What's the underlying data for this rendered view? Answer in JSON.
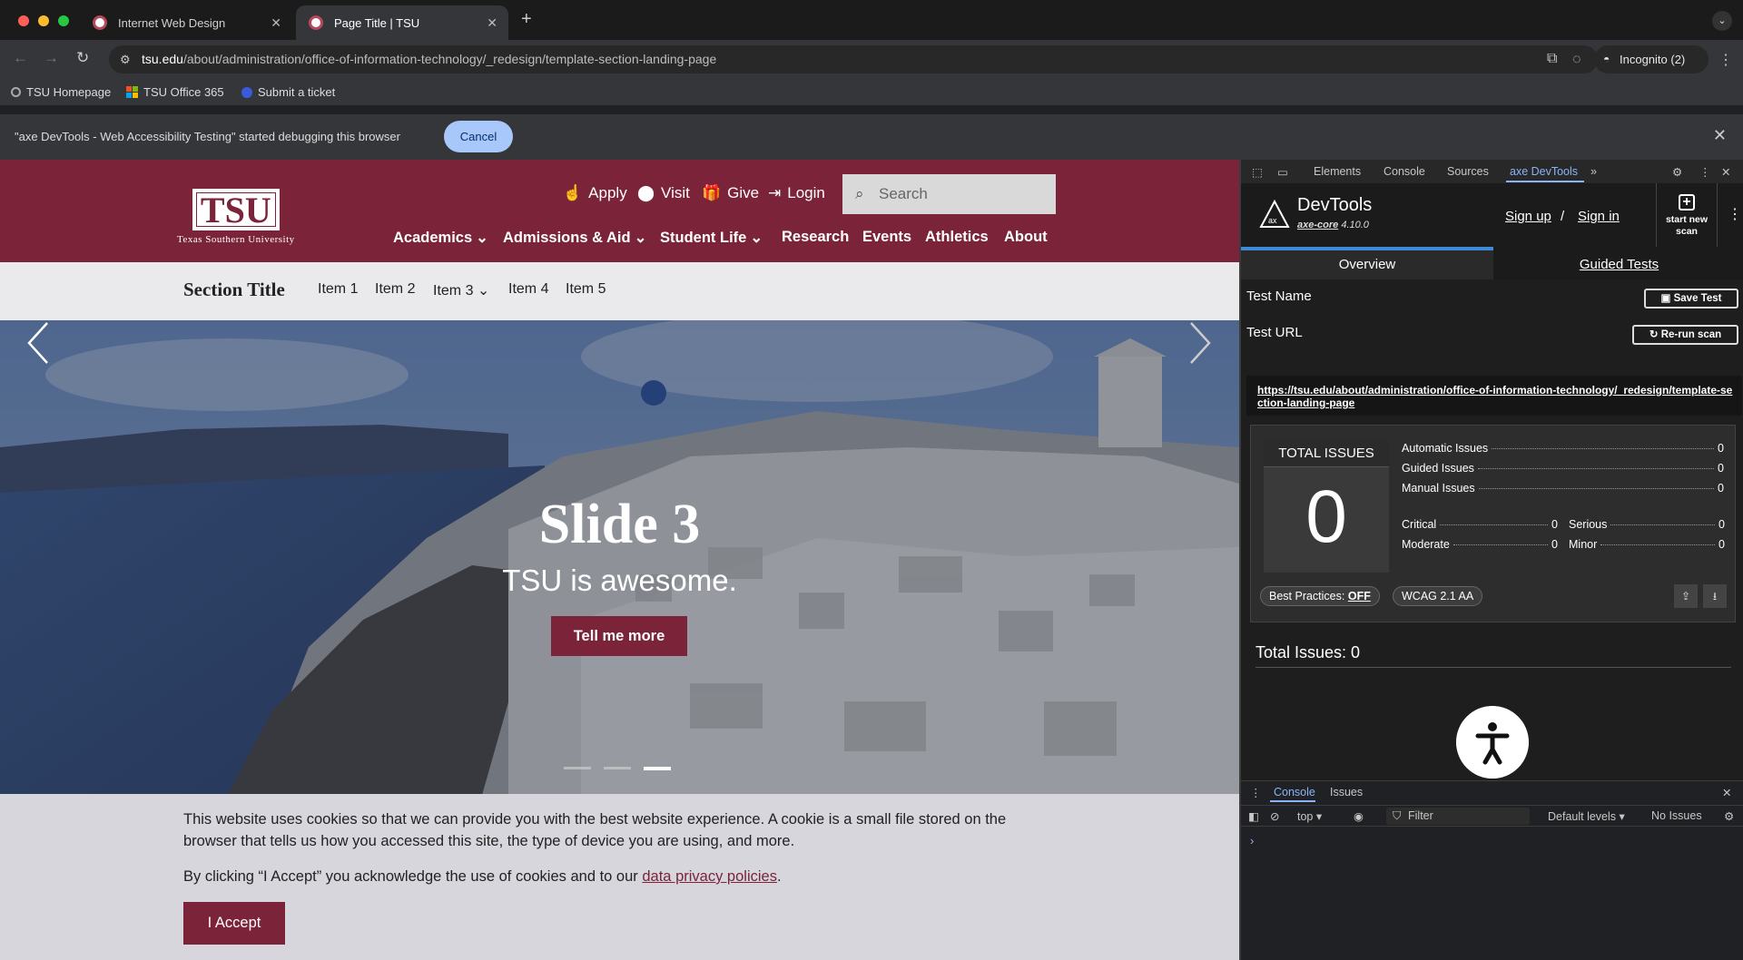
{
  "browser": {
    "tabs": [
      {
        "title": "Internet Web Design",
        "active": false
      },
      {
        "title": "Page Title | TSU",
        "active": true
      }
    ],
    "url_host": "tsu.edu",
    "url_path": "/about/administration/office-of-information-technology/_redesign/template-section-landing-page",
    "profile": "Incognito (2)",
    "bookmarks": [
      "TSU Homepage",
      "TSU Office 365",
      "Submit a ticket"
    ],
    "infobar_message": "\"axe DevTools - Web Accessibility Testing\" started debugging this browser",
    "infobar_cancel": "Cancel"
  },
  "site": {
    "logo_text": "TSU",
    "logo_subtitle": "Texas Southern University",
    "utility": [
      "Apply",
      "Visit",
      "Give",
      "Login"
    ],
    "search_placeholder": "Search",
    "nav": [
      "Academics",
      "Admissions & Aid",
      "Student Life",
      "Research",
      "Events",
      "Athletics",
      "About"
    ],
    "section_title": "Section Title",
    "section_items": [
      "Item 1",
      "Item 2",
      "Item 3",
      "Item 4",
      "Item 5"
    ],
    "brand_color": "#7b2339"
  },
  "hero": {
    "title": "Slide 3",
    "subtitle": "TSU is awesome.",
    "button": "Tell me more",
    "slides": 3,
    "active_slide": 3
  },
  "cookie": {
    "text1": "This website uses cookies so that we can provide you with the best website experience. A cookie is a small file stored on the browser that tells us how you accessed this site, the type of device you are using, and more.",
    "text2_pre": "By clicking “I Accept” you acknowledge the use of cookies and to our ",
    "text2_link": "data privacy policies",
    "text2_post": ".",
    "accept": "I Accept"
  },
  "devtools": {
    "tabs": [
      "Elements",
      "Console",
      "Sources",
      "axe DevTools"
    ],
    "active_tab": "axe DevTools",
    "axe": {
      "title": "DevTools",
      "core_label": "axe-core",
      "core_version": "4.10.0",
      "sign_up": "Sign up",
      "slash": "/",
      "sign_in": "Sign in",
      "start_scan": "start new scan",
      "tab_overview": "Overview",
      "tab_guided": "Guided Tests",
      "test_name_label": "Test Name",
      "save_test": "Save Test",
      "test_url_label": "Test URL",
      "rerun": "Re-run scan",
      "test_url": "https://tsu.edu/about/administration/office-of-information-technology/_redesign/template-section-landing-page",
      "total_label": "TOTAL ISSUES",
      "total": "0",
      "automatic_label": "Automatic Issues",
      "automatic": "0",
      "guided_label": "Guided Issues",
      "guided": "0",
      "manual_label": "Manual Issues",
      "manual": "0",
      "critical_label": "Critical",
      "critical": "0",
      "serious_label": "Serious",
      "serious": "0",
      "moderate_label": "Moderate",
      "moderate": "0",
      "minor_label": "Minor",
      "minor": "0",
      "best_practices_label": "Best Practices:",
      "best_practices_value": "OFF",
      "standard": "WCAG 2.1 AA",
      "total_issues_heading": "Total Issues: 0"
    },
    "drawer": {
      "tabs": [
        "Console",
        "Issues"
      ],
      "context": "top",
      "filter": "Filter",
      "levels": "Default levels",
      "issues": "No Issues"
    }
  }
}
